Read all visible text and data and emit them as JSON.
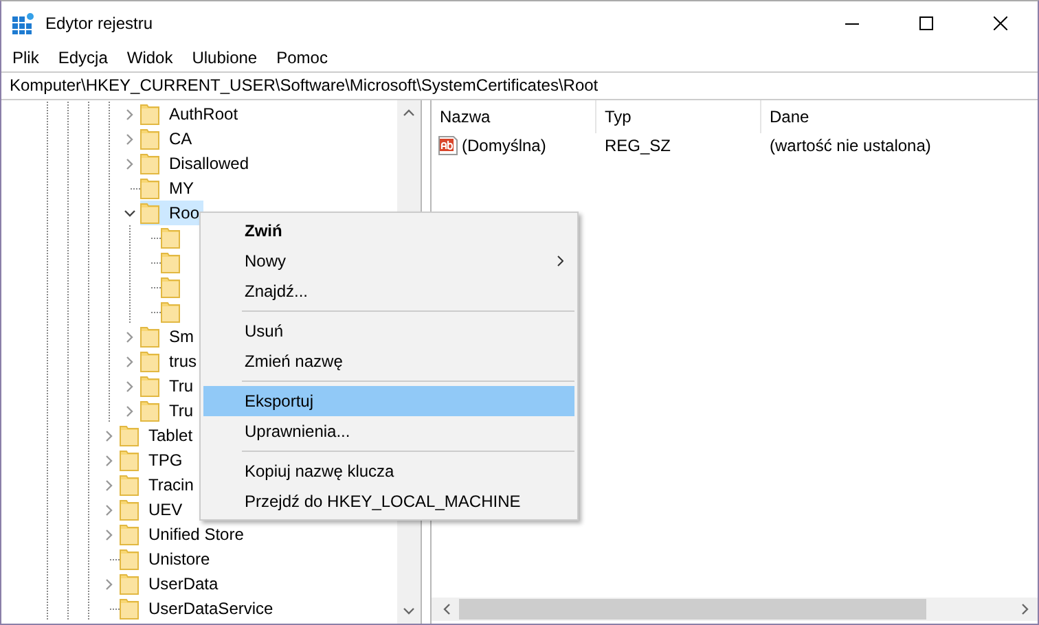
{
  "window": {
    "title": "Edytor rejestru"
  },
  "menu_bar": [
    "Plik",
    "Edycja",
    "Widok",
    "Ulubione",
    "Pomoc"
  ],
  "address_bar": {
    "value": "Komputer\\HKEY_CURRENT_USER\\Software\\Microsoft\\SystemCertificates\\Root"
  },
  "tree": {
    "continued_children": [
      {
        "label": "AuthRoot",
        "expandable": true,
        "expanded": false,
        "selected": false
      },
      {
        "label": "CA",
        "expandable": true,
        "expanded": false,
        "selected": false
      },
      {
        "label": "Disallowed",
        "expandable": true,
        "expanded": false,
        "selected": false
      },
      {
        "label": "MY",
        "expandable": false,
        "selected": false
      },
      {
        "label": "Roo",
        "expandable": true,
        "expanded": true,
        "selected": true,
        "children": [
          {
            "expandable": false,
            "selected": false
          },
          {
            "expandable": false,
            "selected": false
          },
          {
            "expandable": false,
            "selected": false
          },
          {
            "expandable": false,
            "selected": false
          }
        ]
      },
      {
        "label": "Sm",
        "expandable": true,
        "expanded": false,
        "selected": false
      },
      {
        "label": "trus",
        "expandable": true,
        "expanded": false,
        "selected": false
      },
      {
        "label": "Tru",
        "expandable": true,
        "expanded": false,
        "selected": false
      },
      {
        "label": "Tru",
        "expandable": true,
        "expanded": false,
        "selected": false
      }
    ],
    "items": [
      {
        "label": "Tablet",
        "expandable": true,
        "expanded": false,
        "selected": false
      },
      {
        "label": "TPG",
        "expandable": true,
        "expanded": false,
        "selected": false
      },
      {
        "label": "Tracin",
        "expandable": true,
        "expanded": false,
        "selected": false
      },
      {
        "label": "UEV",
        "expandable": true,
        "expanded": false,
        "selected": false
      },
      {
        "label": "Unified Store",
        "expandable": true,
        "expanded": false,
        "selected": false
      },
      {
        "label": "Unistore",
        "expandable": false,
        "selected": false
      },
      {
        "label": "UserData",
        "expandable": true,
        "expanded": false,
        "selected": false
      },
      {
        "label": "UserDataService",
        "expandable": false,
        "selected": false
      }
    ]
  },
  "values_table": {
    "columns": [
      "Nazwa",
      "Typ",
      "Dane"
    ],
    "rows": [
      {
        "name": "(Domyślna)",
        "type": "REG_SZ",
        "data": "(wartość nie ustalona)"
      }
    ]
  },
  "context_menu": {
    "items": [
      {
        "kind": "item",
        "label": "Zwiń",
        "default": true,
        "submenu": false,
        "selected": false
      },
      {
        "kind": "item",
        "label": "Nowy",
        "default": false,
        "submenu": true,
        "selected": false
      },
      {
        "kind": "item",
        "label": "Znajdź...",
        "default": false,
        "submenu": false,
        "selected": false
      },
      {
        "kind": "separator"
      },
      {
        "kind": "item",
        "label": "Usuń",
        "default": false,
        "submenu": false,
        "selected": false
      },
      {
        "kind": "item",
        "label": "Zmień nazwę",
        "default": false,
        "submenu": false,
        "selected": false
      },
      {
        "kind": "separator"
      },
      {
        "kind": "item",
        "label": "Eksportuj",
        "default": false,
        "submenu": false,
        "selected": true
      },
      {
        "kind": "item",
        "label": "Uprawnienia...",
        "default": false,
        "submenu": false,
        "selected": false
      },
      {
        "kind": "separator"
      },
      {
        "kind": "item",
        "label": "Kopiuj nazwę klucza",
        "default": false,
        "submenu": false,
        "selected": false
      },
      {
        "kind": "item",
        "label": "Przejdź do HKEY_LOCAL_MACHINE",
        "default": false,
        "submenu": false,
        "selected": false
      }
    ]
  }
}
